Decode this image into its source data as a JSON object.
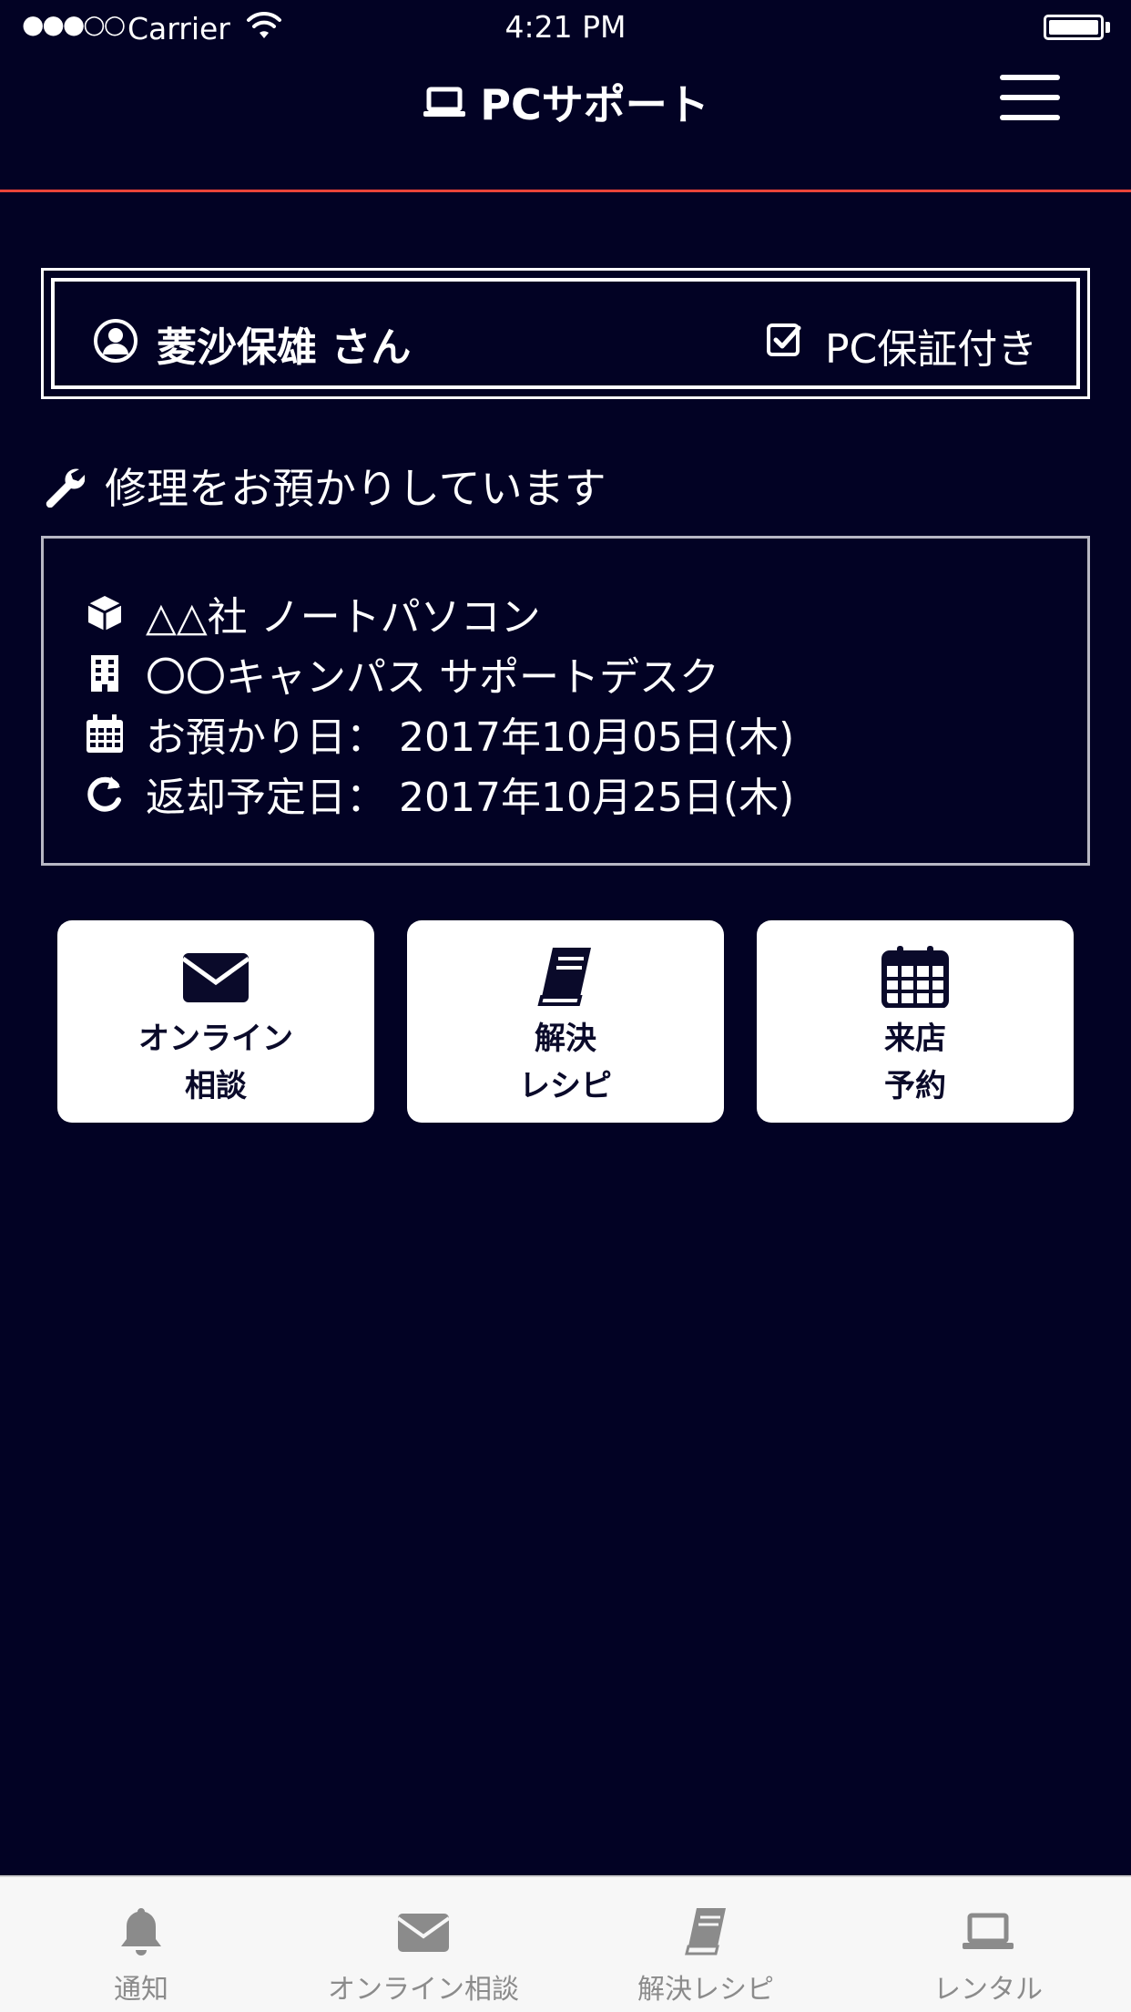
{
  "status_bar": {
    "signal": "●●●○○",
    "carrier": "Carrier",
    "time": "4:21 PM"
  },
  "nav": {
    "title": "PCサポート",
    "title_icon": "laptop-icon",
    "menu_icon": "hamburger-menu-icon"
  },
  "user": {
    "name": "菱沙保雄 さん",
    "warranty": "PC保証付き"
  },
  "repair": {
    "heading": "修理をお預かりしています",
    "device": "△△社 ノートパソコン",
    "location": "〇〇キャンパス サポートデスク",
    "received": "お預かり日： 2017年10月05日(木)",
    "return_due": "返却予定日： 2017年10月25日(木)"
  },
  "tiles": [
    {
      "icon": "envelope-icon",
      "line1": "オンライン",
      "line2": "相談"
    },
    {
      "icon": "book-icon",
      "line1": "解決",
      "line2": "レシピ"
    },
    {
      "icon": "calendar-icon",
      "line1": "来店",
      "line2": "予約"
    }
  ],
  "tab_bar": [
    {
      "icon": "bell-icon",
      "label": "通知"
    },
    {
      "icon": "envelope-icon",
      "label": "オンライン相談"
    },
    {
      "icon": "book-icon",
      "label": "解決レシピ"
    },
    {
      "icon": "laptop-icon",
      "label": "レンタル"
    }
  ],
  "colors": {
    "background": "#020224",
    "accent_rule": "#e8443a",
    "tab_bar_bg": "#f7f7f7",
    "tab_inactive": "#8b8b8b"
  }
}
